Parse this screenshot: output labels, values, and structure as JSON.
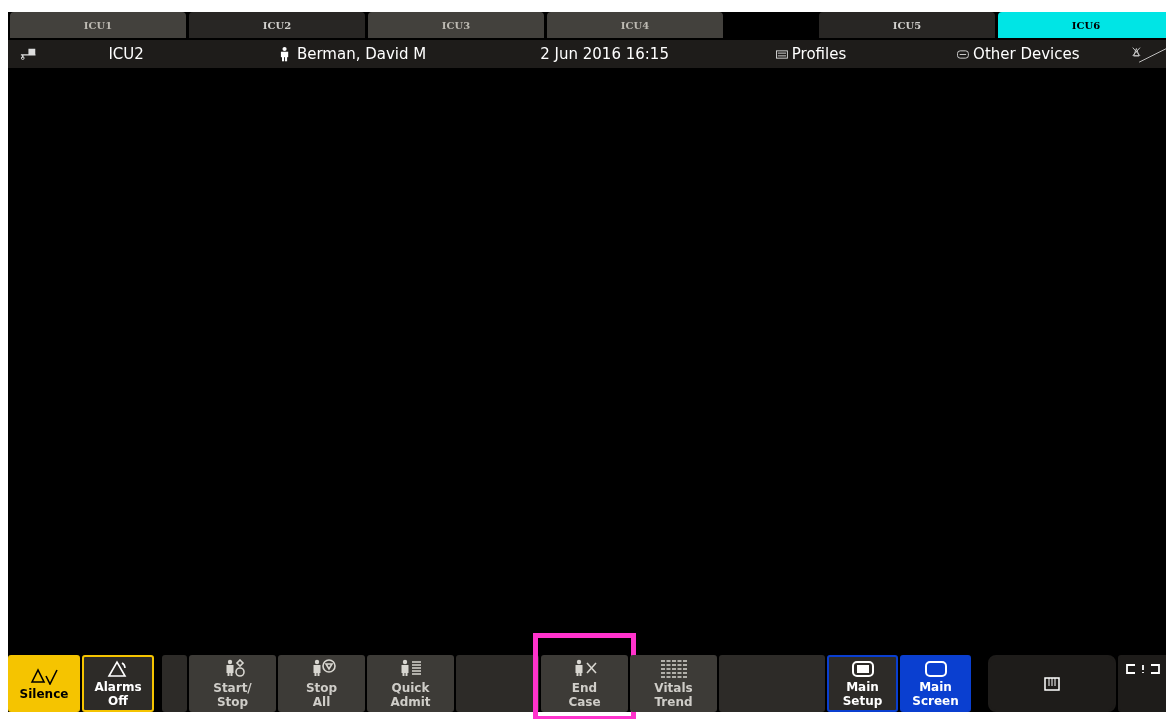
{
  "tabs": [
    {
      "kind": "tab",
      "label": "ICU1",
      "selected": false,
      "current": false
    },
    {
      "kind": "tab",
      "label": "ICU2",
      "selected": false,
      "current": true
    },
    {
      "kind": "tab",
      "label": "ICU3",
      "selected": false,
      "current": false
    },
    {
      "kind": "tab",
      "label": "ICU4",
      "selected": false,
      "current": false
    },
    {
      "kind": "empty"
    },
    {
      "kind": "tab",
      "label": "ICU5",
      "selected": false,
      "current": true
    },
    {
      "kind": "tab",
      "label": "ICU6",
      "selected": true,
      "current": false
    }
  ],
  "header": {
    "bed": "ICU2",
    "patient": "Berman, David M",
    "datetime": "2 Jun 2016 16:15",
    "profiles": "Profiles",
    "other_devices": "Other Devices"
  },
  "keys": [
    {
      "kind": "alarm",
      "label": "Silence",
      "selected": true
    },
    {
      "kind": "alarm",
      "label": "Alarms Off",
      "selected": false
    },
    {
      "kind": "stub"
    },
    {
      "kind": "action",
      "label": "Start/ Stop",
      "highlighted": false
    },
    {
      "kind": "action",
      "label": "Stop All",
      "highlighted": false
    },
    {
      "kind": "action",
      "label": "Quick Admit",
      "highlighted": false
    },
    {
      "kind": "blank"
    },
    {
      "kind": "action",
      "label": "End Case",
      "highlighted": true
    },
    {
      "kind": "action",
      "label": "Vitals Trend",
      "highlighted": false
    },
    {
      "kind": "blank"
    },
    {
      "kind": "screen",
      "label": "Main Setup",
      "selected": false
    },
    {
      "kind": "screen",
      "label": "Main Screen",
      "selected": true
    },
    {
      "kind": "panel"
    },
    {
      "kind": "more"
    }
  ]
}
